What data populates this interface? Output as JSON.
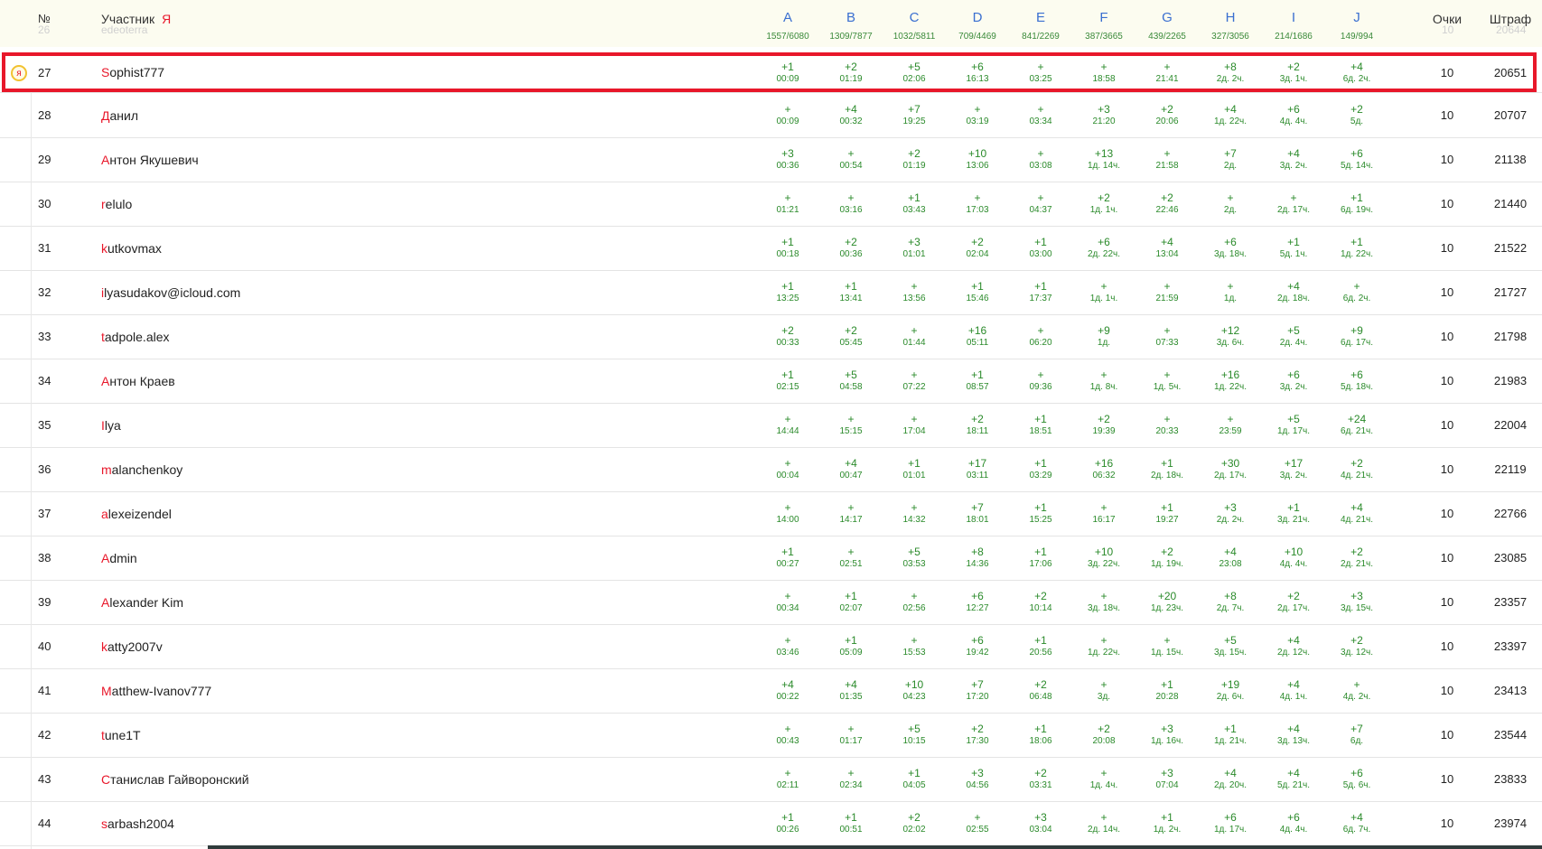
{
  "header": {
    "num_label": "№",
    "participant_label": "Участник",
    "me_mark": "Я",
    "points_label": "Очки",
    "penalty_label": "Штраф",
    "problems": [
      {
        "letter": "A",
        "stats": "1557/6080"
      },
      {
        "letter": "B",
        "stats": "1309/7877"
      },
      {
        "letter": "C",
        "stats": "1032/5811"
      },
      {
        "letter": "D",
        "stats": "709/4469"
      },
      {
        "letter": "E",
        "stats": "841/2269"
      },
      {
        "letter": "F",
        "stats": "387/3665"
      },
      {
        "letter": "G",
        "stats": "439/2265"
      },
      {
        "letter": "H",
        "stats": "327/3056"
      },
      {
        "letter": "I",
        "stats": "214/1686"
      },
      {
        "letter": "J",
        "stats": "149/994"
      }
    ]
  },
  "ghost_row": {
    "num": "26",
    "name": "edeoterra",
    "points": "10",
    "penalty": "20644"
  },
  "me_badge": "я",
  "colors": {
    "accent_red": "#e8172a",
    "result_green": "#2a8a2a",
    "problem_blue": "#3a6fd0",
    "header_bg": "#fcfcf0",
    "badge_border": "#f2c230"
  },
  "rows": [
    {
      "num": "27",
      "first": "S",
      "rest": "ophist777",
      "me": true,
      "points": "10",
      "penalty": "20651",
      "res": [
        [
          "+1",
          "00:09"
        ],
        [
          "+2",
          "01:19"
        ],
        [
          "+5",
          "02:06"
        ],
        [
          "+6",
          "16:13"
        ],
        [
          "+",
          "03:25"
        ],
        [
          "+",
          "18:58"
        ],
        [
          "+",
          "21:41"
        ],
        [
          "+8",
          "2д. 2ч."
        ],
        [
          "+2",
          "3д. 1ч."
        ],
        [
          "+4",
          "6д. 2ч."
        ]
      ]
    },
    {
      "num": "28",
      "first": "Д",
      "rest": "анил",
      "points": "10",
      "penalty": "20707",
      "res": [
        [
          "+",
          "00:09"
        ],
        [
          "+4",
          "00:32"
        ],
        [
          "+7",
          "19:25"
        ],
        [
          "+",
          "03:19"
        ],
        [
          "+",
          "03:34"
        ],
        [
          "+3",
          "21:20"
        ],
        [
          "+2",
          "20:06"
        ],
        [
          "+4",
          "1д. 22ч."
        ],
        [
          "+6",
          "4д. 4ч."
        ],
        [
          "+2",
          "5д."
        ]
      ]
    },
    {
      "num": "29",
      "first": "А",
      "rest": "нтон Якушевич",
      "points": "10",
      "penalty": "21138",
      "res": [
        [
          "+3",
          "00:36"
        ],
        [
          "+",
          "00:54"
        ],
        [
          "+2",
          "01:19"
        ],
        [
          "+10",
          "13:06"
        ],
        [
          "+",
          "03:08"
        ],
        [
          "+13",
          "1д. 14ч."
        ],
        [
          "+",
          "21:58"
        ],
        [
          "+7",
          "2д."
        ],
        [
          "+4",
          "3д. 2ч."
        ],
        [
          "+6",
          "5д. 14ч."
        ]
      ]
    },
    {
      "num": "30",
      "first": "r",
      "rest": "elulo",
      "points": "10",
      "penalty": "21440",
      "res": [
        [
          "+",
          "01:21"
        ],
        [
          "+",
          "03:16"
        ],
        [
          "+1",
          "03:43"
        ],
        [
          "+",
          "17:03"
        ],
        [
          "+",
          "04:37"
        ],
        [
          "+2",
          "1д. 1ч."
        ],
        [
          "+2",
          "22:46"
        ],
        [
          "+",
          "2д."
        ],
        [
          "+",
          "2д. 17ч."
        ],
        [
          "+1",
          "6д. 19ч."
        ]
      ]
    },
    {
      "num": "31",
      "first": "k",
      "rest": "utkovmax",
      "points": "10",
      "penalty": "21522",
      "res": [
        [
          "+1",
          "00:18"
        ],
        [
          "+2",
          "00:36"
        ],
        [
          "+3",
          "01:01"
        ],
        [
          "+2",
          "02:04"
        ],
        [
          "+1",
          "03:00"
        ],
        [
          "+6",
          "2д. 22ч."
        ],
        [
          "+4",
          "13:04"
        ],
        [
          "+6",
          "3д. 18ч."
        ],
        [
          "+1",
          "5д. 1ч."
        ],
        [
          "+1",
          "1д. 22ч."
        ]
      ]
    },
    {
      "num": "32",
      "first": "i",
      "rest": "lyasudakov@icloud.com",
      "points": "10",
      "penalty": "21727",
      "res": [
        [
          "+1",
          "13:25"
        ],
        [
          "+1",
          "13:41"
        ],
        [
          "+",
          "13:56"
        ],
        [
          "+1",
          "15:46"
        ],
        [
          "+1",
          "17:37"
        ],
        [
          "+",
          "1д. 1ч."
        ],
        [
          "+",
          "21:59"
        ],
        [
          "+",
          "1д."
        ],
        [
          "+4",
          "2д. 18ч."
        ],
        [
          "+",
          "6д. 2ч."
        ]
      ]
    },
    {
      "num": "33",
      "first": "t",
      "rest": "adpole.alex",
      "points": "10",
      "penalty": "21798",
      "res": [
        [
          "+2",
          "00:33"
        ],
        [
          "+2",
          "05:45"
        ],
        [
          "+",
          "01:44"
        ],
        [
          "+16",
          "05:11"
        ],
        [
          "+",
          "06:20"
        ],
        [
          "+9",
          "1д."
        ],
        [
          "+",
          "07:33"
        ],
        [
          "+12",
          "3д. 6ч."
        ],
        [
          "+5",
          "2д. 4ч."
        ],
        [
          "+9",
          "6д. 17ч."
        ]
      ]
    },
    {
      "num": "34",
      "first": "А",
      "rest": "нтон Краев",
      "points": "10",
      "penalty": "21983",
      "res": [
        [
          "+1",
          "02:15"
        ],
        [
          "+5",
          "04:58"
        ],
        [
          "+",
          "07:22"
        ],
        [
          "+1",
          "08:57"
        ],
        [
          "+",
          "09:36"
        ],
        [
          "+",
          "1д. 8ч."
        ],
        [
          "+",
          "1д. 5ч."
        ],
        [
          "+16",
          "1д. 22ч."
        ],
        [
          "+6",
          "3д. 2ч."
        ],
        [
          "+6",
          "5д. 18ч."
        ]
      ]
    },
    {
      "num": "35",
      "first": "I",
      "rest": "lya",
      "points": "10",
      "penalty": "22004",
      "res": [
        [
          "+",
          "14:44"
        ],
        [
          "+",
          "15:15"
        ],
        [
          "+",
          "17:04"
        ],
        [
          "+2",
          "18:11"
        ],
        [
          "+1",
          "18:51"
        ],
        [
          "+2",
          "19:39"
        ],
        [
          "+",
          "20:33"
        ],
        [
          "+",
          "23:59"
        ],
        [
          "+5",
          "1д. 17ч."
        ],
        [
          "+24",
          "6д. 21ч."
        ]
      ]
    },
    {
      "num": "36",
      "first": "m",
      "rest": "alanchenkoy",
      "points": "10",
      "penalty": "22119",
      "res": [
        [
          "+",
          "00:04"
        ],
        [
          "+4",
          "00:47"
        ],
        [
          "+1",
          "01:01"
        ],
        [
          "+17",
          "03:11"
        ],
        [
          "+1",
          "03:29"
        ],
        [
          "+16",
          "06:32"
        ],
        [
          "+1",
          "2д. 18ч."
        ],
        [
          "+30",
          "2д. 17ч."
        ],
        [
          "+17",
          "3д. 2ч."
        ],
        [
          "+2",
          "4д. 21ч."
        ]
      ]
    },
    {
      "num": "37",
      "first": "a",
      "rest": "lexeizendel",
      "points": "10",
      "penalty": "22766",
      "res": [
        [
          "+",
          "14:00"
        ],
        [
          "+",
          "14:17"
        ],
        [
          "+",
          "14:32"
        ],
        [
          "+7",
          "18:01"
        ],
        [
          "+1",
          "15:25"
        ],
        [
          "+",
          "16:17"
        ],
        [
          "+1",
          "19:27"
        ],
        [
          "+3",
          "2д. 2ч."
        ],
        [
          "+1",
          "3д. 21ч."
        ],
        [
          "+4",
          "4д. 21ч."
        ]
      ]
    },
    {
      "num": "38",
      "first": "A",
      "rest": "dmin",
      "points": "10",
      "penalty": "23085",
      "res": [
        [
          "+1",
          "00:27"
        ],
        [
          "+",
          "02:51"
        ],
        [
          "+5",
          "03:53"
        ],
        [
          "+8",
          "14:36"
        ],
        [
          "+1",
          "17:06"
        ],
        [
          "+10",
          "3д. 22ч."
        ],
        [
          "+2",
          "1д. 19ч."
        ],
        [
          "+4",
          "23:08"
        ],
        [
          "+10",
          "4д. 4ч."
        ],
        [
          "+2",
          "2д. 21ч."
        ]
      ]
    },
    {
      "num": "39",
      "first": "A",
      "rest": "lexander Kim",
      "points": "10",
      "penalty": "23357",
      "res": [
        [
          "+",
          "00:34"
        ],
        [
          "+1",
          "02:07"
        ],
        [
          "+",
          "02:56"
        ],
        [
          "+6",
          "12:27"
        ],
        [
          "+2",
          "10:14"
        ],
        [
          "+",
          "3д. 18ч."
        ],
        [
          "+20",
          "1д. 23ч."
        ],
        [
          "+8",
          "2д. 7ч."
        ],
        [
          "+2",
          "2д. 17ч."
        ],
        [
          "+3",
          "3д. 15ч."
        ]
      ]
    },
    {
      "num": "40",
      "first": "k",
      "rest": "atty2007v",
      "points": "10",
      "penalty": "23397",
      "res": [
        [
          "+",
          "03:46"
        ],
        [
          "+1",
          "05:09"
        ],
        [
          "+",
          "15:53"
        ],
        [
          "+6",
          "19:42"
        ],
        [
          "+1",
          "20:56"
        ],
        [
          "+",
          "1д. 22ч."
        ],
        [
          "+",
          "1д. 15ч."
        ],
        [
          "+5",
          "3д. 15ч."
        ],
        [
          "+4",
          "2д. 12ч."
        ],
        [
          "+2",
          "3д. 12ч."
        ]
      ]
    },
    {
      "num": "41",
      "first": "M",
      "rest": "atthew-Ivanov777",
      "points": "10",
      "penalty": "23413",
      "res": [
        [
          "+4",
          "00:22"
        ],
        [
          "+4",
          "01:35"
        ],
        [
          "+10",
          "04:23"
        ],
        [
          "+7",
          "17:20"
        ],
        [
          "+2",
          "06:48"
        ],
        [
          "+",
          "3д."
        ],
        [
          "+1",
          "20:28"
        ],
        [
          "+19",
          "2д. 6ч."
        ],
        [
          "+4",
          "4д. 1ч."
        ],
        [
          "+",
          "4д. 2ч."
        ]
      ]
    },
    {
      "num": "42",
      "first": "t",
      "rest": "une1T",
      "points": "10",
      "penalty": "23544",
      "res": [
        [
          "+",
          "00:43"
        ],
        [
          "+",
          "01:17"
        ],
        [
          "+5",
          "10:15"
        ],
        [
          "+2",
          "17:30"
        ],
        [
          "+1",
          "18:06"
        ],
        [
          "+2",
          "20:08"
        ],
        [
          "+3",
          "1д. 16ч."
        ],
        [
          "+1",
          "1д. 21ч."
        ],
        [
          "+4",
          "3д. 13ч."
        ],
        [
          "+7",
          "6д."
        ]
      ]
    },
    {
      "num": "43",
      "first": "С",
      "rest": "танислав Гайворонский",
      "points": "10",
      "penalty": "23833",
      "res": [
        [
          "+",
          "02:11"
        ],
        [
          "+",
          "02:34"
        ],
        [
          "+1",
          "04:05"
        ],
        [
          "+3",
          "04:56"
        ],
        [
          "+2",
          "03:31"
        ],
        [
          "+",
          "1д. 4ч."
        ],
        [
          "+3",
          "07:04"
        ],
        [
          "+4",
          "2д. 20ч."
        ],
        [
          "+4",
          "5д. 21ч."
        ],
        [
          "+6",
          "5д. 6ч."
        ]
      ]
    },
    {
      "num": "44",
      "first": "s",
      "rest": "arbash2004",
      "points": "10",
      "penalty": "23974",
      "res": [
        [
          "+1",
          "00:26"
        ],
        [
          "+1",
          "00:51"
        ],
        [
          "+2",
          "02:02"
        ],
        [
          "+",
          "02:55"
        ],
        [
          "+3",
          "03:04"
        ],
        [
          "+",
          "2д. 14ч."
        ],
        [
          "+1",
          "1д. 2ч."
        ],
        [
          "+6",
          "1д. 17ч."
        ],
        [
          "+6",
          "4д. 4ч."
        ],
        [
          "+4",
          "6д. 7ч."
        ]
      ]
    }
  ]
}
